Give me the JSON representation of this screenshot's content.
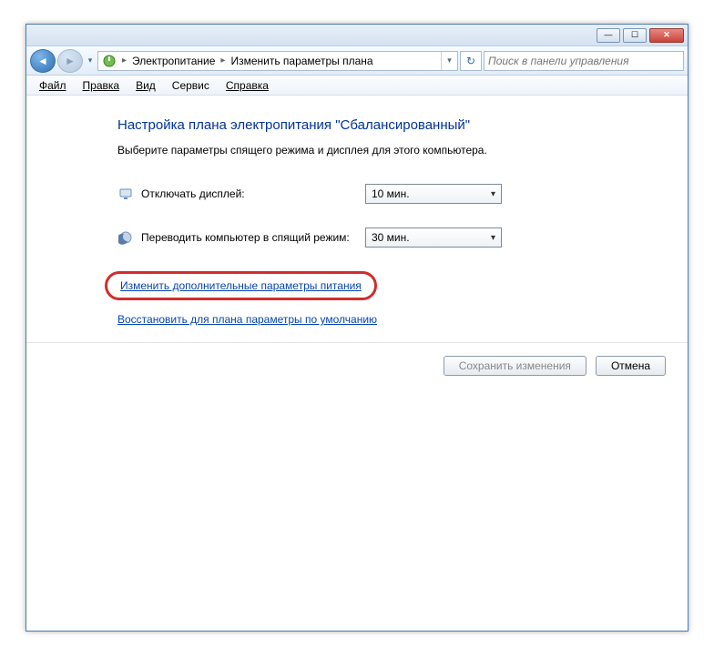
{
  "breadcrumb": {
    "root": "Электропитание",
    "current": "Изменить параметры плана"
  },
  "search": {
    "placeholder": "Поиск в панели управления"
  },
  "menu": {
    "file": "Файл",
    "edit": "Правка",
    "view": "Вид",
    "service": "Сервис",
    "help": "Справка"
  },
  "heading": "Настройка плана электропитания \"Сбалансированный\"",
  "subtext": "Выберите параметры спящего режима и дисплея для этого компьютера.",
  "rows": {
    "display_off": {
      "label": "Отключать дисплей:",
      "value": "10 мин."
    },
    "sleep": {
      "label": "Переводить компьютер в спящий режим:",
      "value": "30 мин."
    }
  },
  "links": {
    "advanced": "Изменить дополнительные параметры питания",
    "restore": "Восстановить для плана параметры по умолчанию"
  },
  "buttons": {
    "save": "Сохранить изменения",
    "cancel": "Отмена"
  }
}
